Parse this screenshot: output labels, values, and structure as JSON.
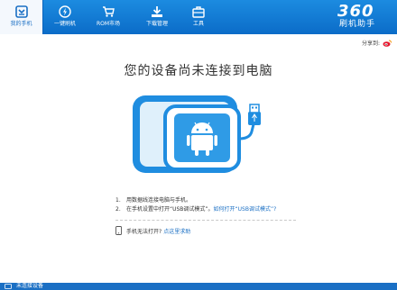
{
  "nav": {
    "tabs": [
      {
        "label": "我的手机",
        "icon": "phone-icon",
        "active": true
      },
      {
        "label": "一键刷机",
        "icon": "flash-icon",
        "active": false
      },
      {
        "label": "ROM市场",
        "icon": "cart-icon",
        "active": false
      },
      {
        "label": "下载管理",
        "icon": "download-icon",
        "active": false
      },
      {
        "label": "工具",
        "icon": "toolbox-icon",
        "active": false
      }
    ]
  },
  "logo": {
    "number": "360",
    "text": "刷机助手"
  },
  "share": {
    "label": "分享到:",
    "icon": "weibo-icon"
  },
  "main": {
    "title": "您的设备尚未连接到电脑",
    "steps": [
      {
        "num": "1.",
        "text": "用数据线连接电脑与手机。"
      },
      {
        "num": "2.",
        "text": "在手机设置中打开“USB调试模式”。",
        "link": "如何打开“USB调试模式”?"
      }
    ],
    "help_text": "手机无法打开?",
    "help_link": "点这里求助"
  },
  "status": {
    "text": "未连接设备"
  },
  "colors": {
    "brand": "#0b6cc8",
    "link": "#1a6fc4",
    "device_blue": "#1f8de0"
  }
}
